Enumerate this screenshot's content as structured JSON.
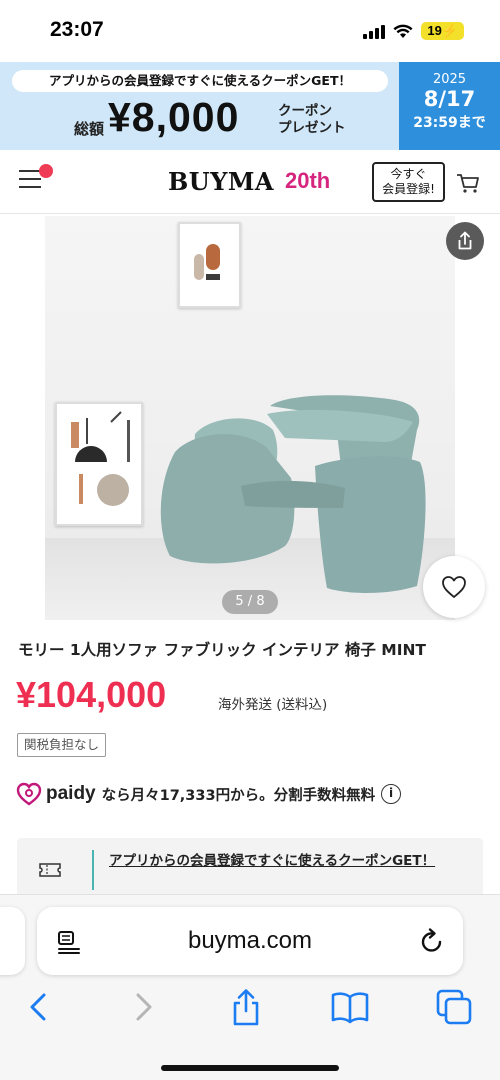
{
  "status_bar": {
    "time": "23:07",
    "battery": "19"
  },
  "promo": {
    "subtitle": "アプリからの会員登録ですぐに使えるクーポンGET！",
    "total_label": "総額",
    "amount": "¥8,000",
    "coupon_line1": "クーポン",
    "coupon_line2": "プレゼント",
    "date_year": "2025",
    "date_day": "8/17",
    "date_time": "23:59まで",
    "colors": {
      "main_bg": "#cfe7f8",
      "date_bg": "#2e8fdc"
    }
  },
  "header": {
    "logo": "BUYMA",
    "logo_badge": "20th",
    "register_line1": "今すぐ",
    "register_line2": "会員登録!",
    "icons": {
      "menu": "hamburger-icon",
      "cart": "cart-icon"
    }
  },
  "gallery": {
    "counter": "5 / 8",
    "icons": {
      "share": "share-icon",
      "favorite": "heart-icon"
    }
  },
  "product": {
    "title": "モリー 1人用ソファ ファブリック インテリア 椅子 MINT",
    "price": "¥104,000",
    "shipping": "海外発送 (送料込)",
    "duty_badge": "関税負担なし",
    "paidy_brand": "paidy",
    "paidy_text": "なら月々17,333円から。分割手数料無料",
    "price_color": "#ee2f52"
  },
  "coupon": {
    "text": "アプリからの会員登録ですぐに使えるクーポンGET！"
  },
  "browser": {
    "url": "buyma.com",
    "icons": [
      "back-icon",
      "forward-icon",
      "share-icon",
      "bookmarks-icon",
      "tabs-icon"
    ]
  }
}
